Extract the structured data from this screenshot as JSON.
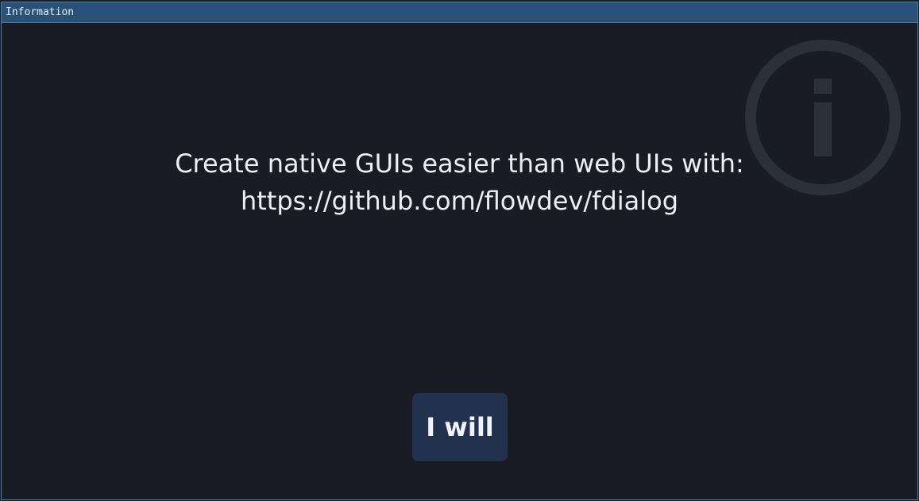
{
  "window": {
    "title": "Information"
  },
  "message": {
    "line1": "Create native GUIs easier than web UIs with:",
    "line2": "https://github.com/flowdev/fdialog"
  },
  "buttons": {
    "confirm_label": "I will"
  },
  "icon": {
    "name": "info-icon",
    "color": "#2c303a"
  },
  "colors": {
    "background": "#191c24",
    "titlebar": "#2a5278",
    "border": "#4d7ba8",
    "button": "#22324e",
    "text": "#eceff3"
  }
}
